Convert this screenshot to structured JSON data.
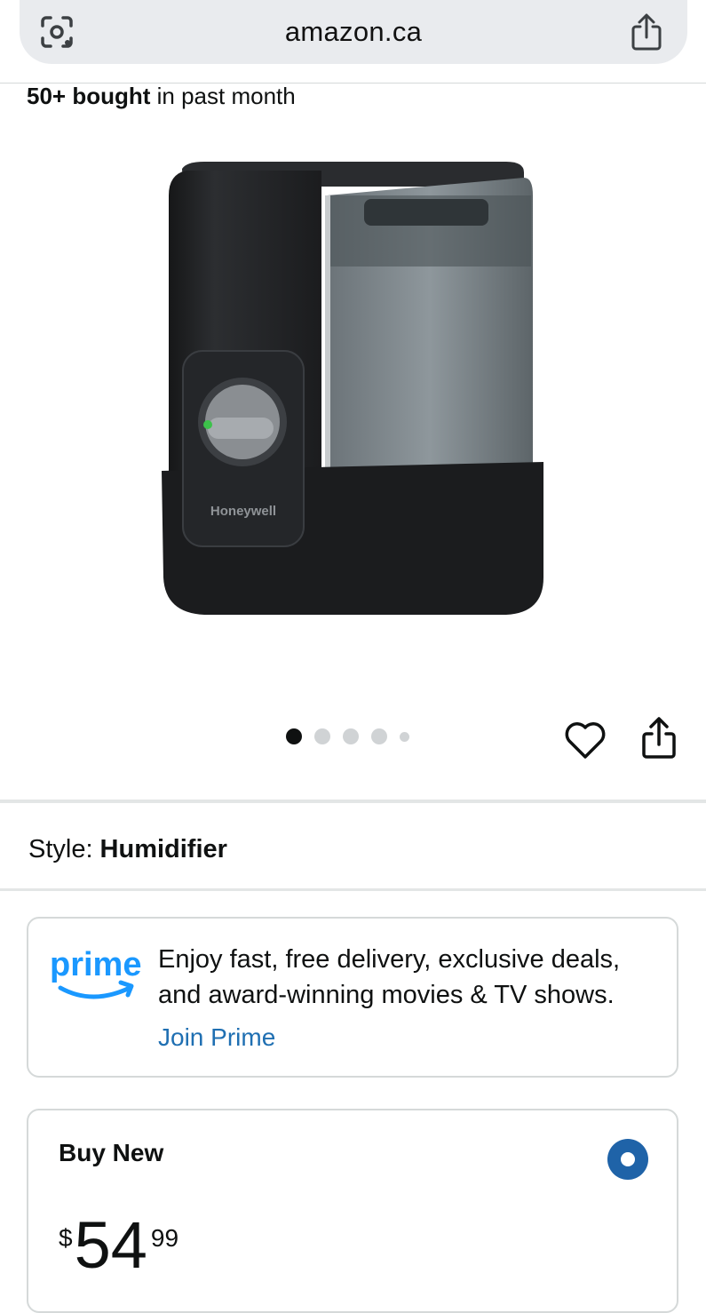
{
  "browser": {
    "url": "amazon.ca",
    "lens_icon": "camera-lens-icon",
    "share_icon": "share-icon"
  },
  "social_proof": {
    "count": "50+ bought",
    "suffix": " in past month"
  },
  "product": {
    "brand": "Honeywell",
    "image_icon": "humidifier-product-image"
  },
  "carousel": {
    "total": 5,
    "active_index": 0
  },
  "actions": {
    "favorite_icon": "heart-icon",
    "share_icon": "share-icon"
  },
  "style": {
    "label": "Style:",
    "value": "Humidifier"
  },
  "prime": {
    "logo_text": "prime",
    "message": "Enjoy fast, free delivery, exclusive deals, and award-winning movies & TV shows.",
    "cta": "Join Prime",
    "brand_color": "#1a98ff"
  },
  "buy_new": {
    "title": "Buy New",
    "currency_symbol": "$",
    "price_whole": "54",
    "price_fraction": "99",
    "selected": true,
    "accent_color": "#1f63a8"
  }
}
